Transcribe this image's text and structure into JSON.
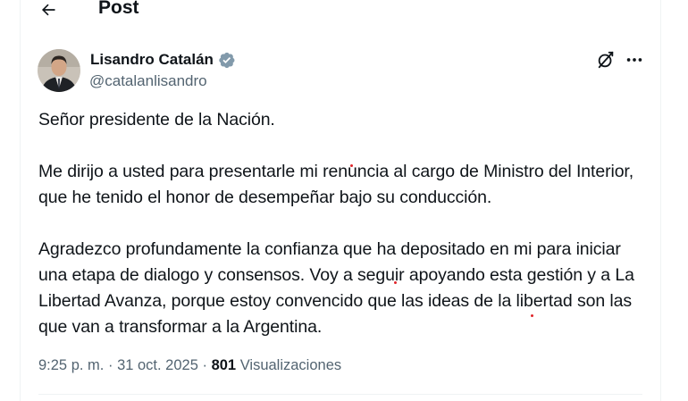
{
  "header": {
    "title": "Post",
    "back_icon": "arrow-left-icon"
  },
  "author": {
    "name": "Lisandro Catalán",
    "handle": "@catalanlisandro",
    "verified_icon": "verified-badge-icon",
    "verified_color": "#829aab"
  },
  "actions": {
    "grok_icon": "grok-icon",
    "more_icon": "more-horizontal-icon"
  },
  "tweet": {
    "paragraphs": [
      "Señor presidente de la Nación.",
      "Me dirijo a usted para presentarle mi renuncia al cargo de Ministro del Interior, que he tenido el honor de desempeñar bajo su conducción.",
      "Agradezco profundamente la confianza que ha depositado en mi para iniciar una etapa de dialogo y consensos. Voy a seguir apoyando esta gestión y a La Libertad Avanza, porque estoy convencido que las ideas de la libertad son las que van a transformar a la Argentina."
    ]
  },
  "meta": {
    "time": "9:25 p. m.",
    "separator": "·",
    "date": "31 oct. 2025",
    "views_count": "801",
    "views_label": "Visualizaciones"
  },
  "colors": {
    "text": "#0f1419",
    "secondary": "#536471",
    "divider": "#eff3f4"
  }
}
